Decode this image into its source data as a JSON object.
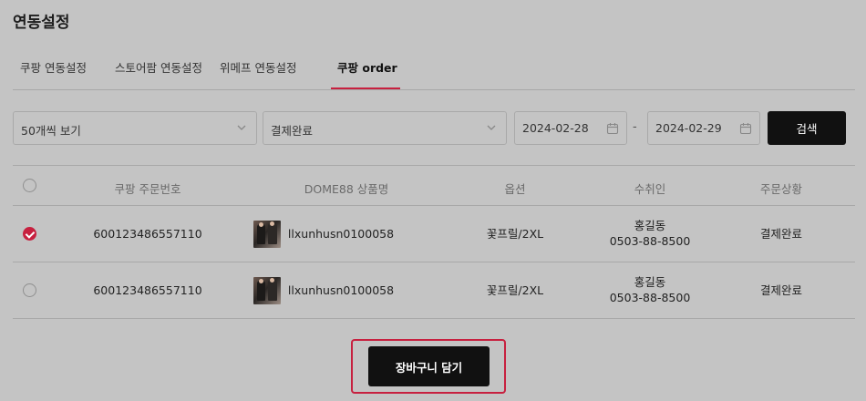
{
  "page": {
    "title": "연동설정"
  },
  "tabs": [
    {
      "label": "쿠팡 연동설정",
      "active": false
    },
    {
      "label": "스토어팜 연동설정",
      "active": false
    },
    {
      "label": "위메프 연동설정",
      "active": false
    },
    {
      "label": "쿠팡 order",
      "active": true
    }
  ],
  "filters": {
    "page_size": "50개씩 보기",
    "status": "결제완료",
    "date_from": "2024-02-28",
    "date_separator": "-",
    "date_to": "2024-02-29",
    "search_label": "검색"
  },
  "table": {
    "headers": [
      "쿠팡 주문번호",
      "DOME88 상품명",
      "옵션",
      "수취인",
      "주문상황"
    ],
    "rows": [
      {
        "checked": true,
        "order_no": "600123486557110",
        "product": "llxunhusn0100058",
        "option": "꽃프릴/2XL",
        "recipient_name": "홍길동",
        "recipient_phone": "0503-88-8500",
        "status": "결제완료"
      },
      {
        "checked": false,
        "order_no": "600123486557110",
        "product": "llxunhusn0100058",
        "option": "꽃프릴/2XL",
        "recipient_name": "홍길동",
        "recipient_phone": "0503-88-8500",
        "status": "결제완료"
      }
    ]
  },
  "actions": {
    "add_to_cart": "장바구니 담기"
  },
  "colors": {
    "accent": "#c7203f",
    "button_dark": "#111111",
    "background": "#c4c4c4"
  },
  "icons": {
    "select_arrow": "chevron-down-icon",
    "date_picker": "calendar-icon",
    "row_select": "radio-check-icon"
  }
}
